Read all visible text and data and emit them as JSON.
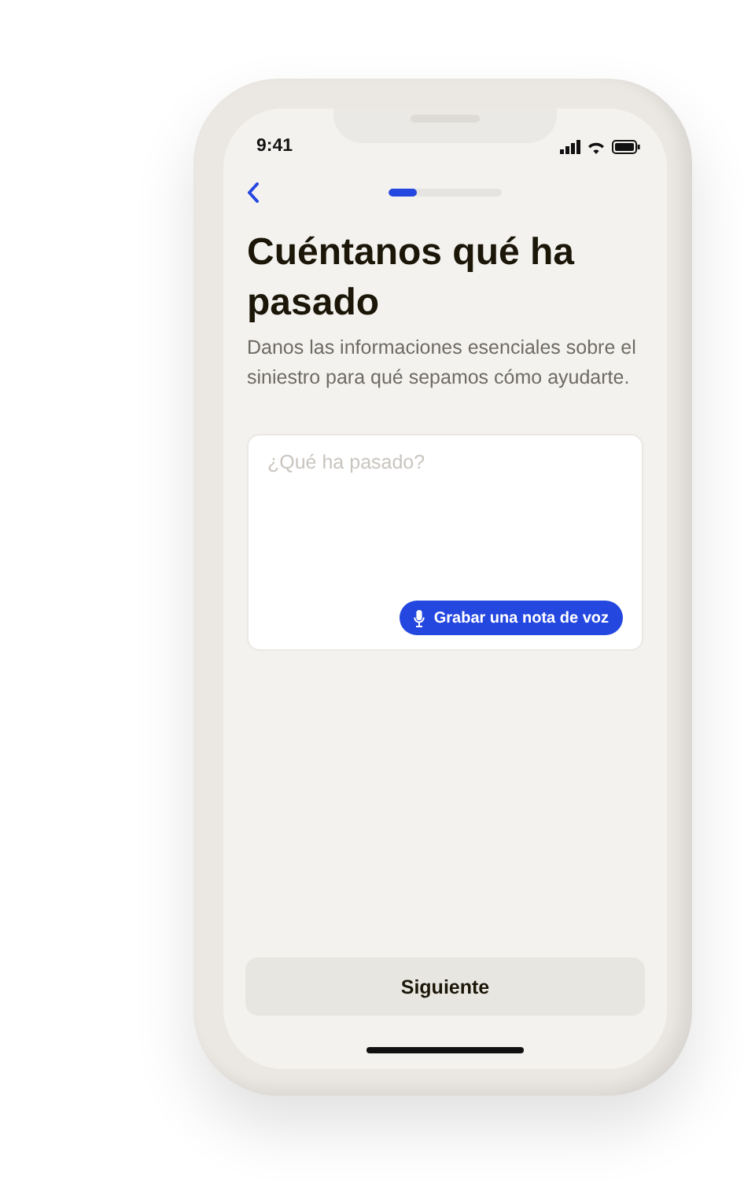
{
  "status_bar": {
    "time": "9:41"
  },
  "progress": {
    "level": 0.25
  },
  "title": "Cuéntanos qué ha pasado",
  "subtitle": "Danos las informaciones esenciales sobre el siniestro para qué sepamos cómo ayudarte.",
  "description_field": {
    "placeholder": "¿Qué ha pasado?"
  },
  "voice_button": {
    "label": "Grabar una nota de voz"
  },
  "next_button": {
    "label": "Siguiente"
  }
}
